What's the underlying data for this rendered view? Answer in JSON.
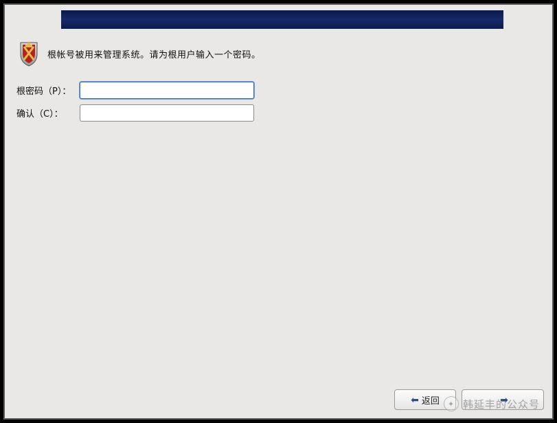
{
  "instruction": "根帐号被用来管理系统。请为根用户输入一个密码。",
  "icon_name": "shield-icon",
  "form": {
    "password_label": "根密码（P）：",
    "confirm_label": "确认（C）：",
    "password_value": "",
    "confirm_value": ""
  },
  "buttons": {
    "back_label": "返回",
    "next_label": ""
  },
  "watermark": {
    "text": "韩延丰的公众号"
  }
}
